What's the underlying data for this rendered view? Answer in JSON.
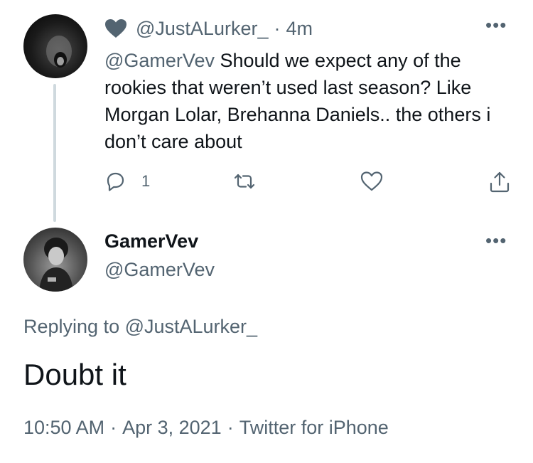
{
  "parent_tweet": {
    "handle": "@JustALurker_",
    "time": "4m",
    "mention": "@GamerVev",
    "text": " Should we expect any of the rookies that weren’t used last season? Like Morgan Lolar, Brehanna Daniels.. the others i don’t care about",
    "reply_count": "1",
    "icons": [
      "heart-icon",
      "reply-icon",
      "retweet-icon",
      "like-icon",
      "share-icon",
      "more-icon"
    ]
  },
  "reply_tweet": {
    "display_name": "GamerVev",
    "handle": "@GamerVev",
    "replying_to": "Replying to @JustALurker_",
    "text": "Doubt it",
    "time": "10:50 AM",
    "date": "Apr 3, 2021",
    "source": "Twitter for iPhone"
  },
  "colors": {
    "text": "#0f1419",
    "secondary": "#536471",
    "thread_line": "#cfd9de"
  }
}
